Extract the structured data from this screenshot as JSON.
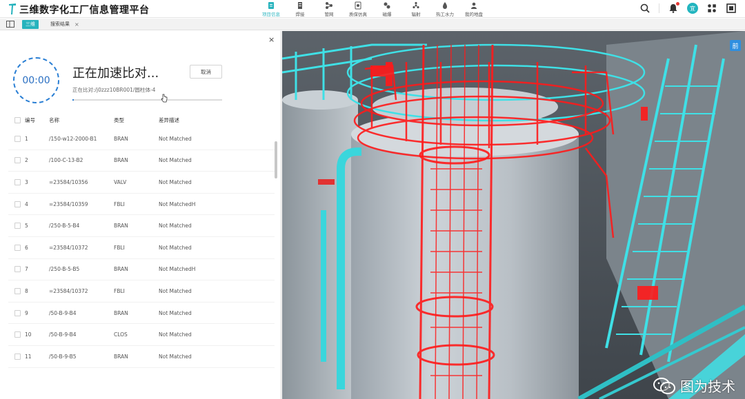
{
  "app": {
    "title": "三维数字化工厂信息管理平台"
  },
  "nav": [
    {
      "label": "项目信息",
      "icon": "document-icon",
      "active": true
    },
    {
      "label": "焊接",
      "icon": "weld-icon"
    },
    {
      "label": "管网",
      "icon": "pipe-network-icon"
    },
    {
      "label": "质保仿真",
      "icon": "simulation-icon"
    },
    {
      "label": "磁爆",
      "icon": "blast-icon"
    },
    {
      "label": "辐射",
      "icon": "radiation-icon"
    },
    {
      "label": "热工水力",
      "icon": "thermal-hydraulics-icon"
    },
    {
      "label": "我的地盘",
      "icon": "user-space-icon"
    }
  ],
  "header_right": {
    "avatar_text": "宜"
  },
  "tabs": {
    "active": "三维",
    "second": "搜索结果",
    "close": "×"
  },
  "panel": {
    "close": "×",
    "timer": "00:00",
    "status_title": "正在加速比对...",
    "cancel_label": "取消",
    "progress_label": "正在比对:/j0zzz10BR001/圆柱体-4",
    "progress_fraction": 0.01
  },
  "table": {
    "headers": {
      "no": "编号",
      "name": "名称",
      "type": "类型",
      "diff": "差异描述"
    },
    "rows": [
      {
        "no": "1",
        "name": "/150-w12-2000-B1",
        "type": "BRAN",
        "diff": "Not Matched"
      },
      {
        "no": "2",
        "name": "/100-C-13-B2",
        "type": "BRAN",
        "diff": "Not Matched"
      },
      {
        "no": "3",
        "name": "=23584/10356",
        "type": "VALV",
        "diff": "Not Matched"
      },
      {
        "no": "4",
        "name": "=23584/10359",
        "type": "FBLI",
        "diff": "Not MatchedH"
      },
      {
        "no": "5",
        "name": "/250-B-5-B4",
        "type": "BRAN",
        "diff": "Not Matched"
      },
      {
        "no": "6",
        "name": "=23584/10372",
        "type": "FBLI",
        "diff": "Not Matched"
      },
      {
        "no": "7",
        "name": "/250-B-5-B5",
        "type": "BRAN",
        "diff": "Not MatchedH"
      },
      {
        "no": "8",
        "name": "=23584/10372",
        "type": "FBLI",
        "diff": "Not Matched"
      },
      {
        "no": "9",
        "name": "/50-B-9-B4",
        "type": "BRAN",
        "diff": "Not Matched"
      },
      {
        "no": "10",
        "name": "/50-B-9-B4",
        "type": "CLOS",
        "diff": "Not Matched"
      },
      {
        "no": "11",
        "name": "/50-B-9-B5",
        "type": "BRAN",
        "diff": "Not Matched"
      }
    ]
  },
  "viewport": {
    "badge": "前",
    "watermark": "图为技术"
  },
  "colors": {
    "accent": "#27b3bd",
    "progress": "#2a7fd4",
    "highlight_red": "#ff1a1a",
    "cyan_structure": "#3fe0e6"
  }
}
